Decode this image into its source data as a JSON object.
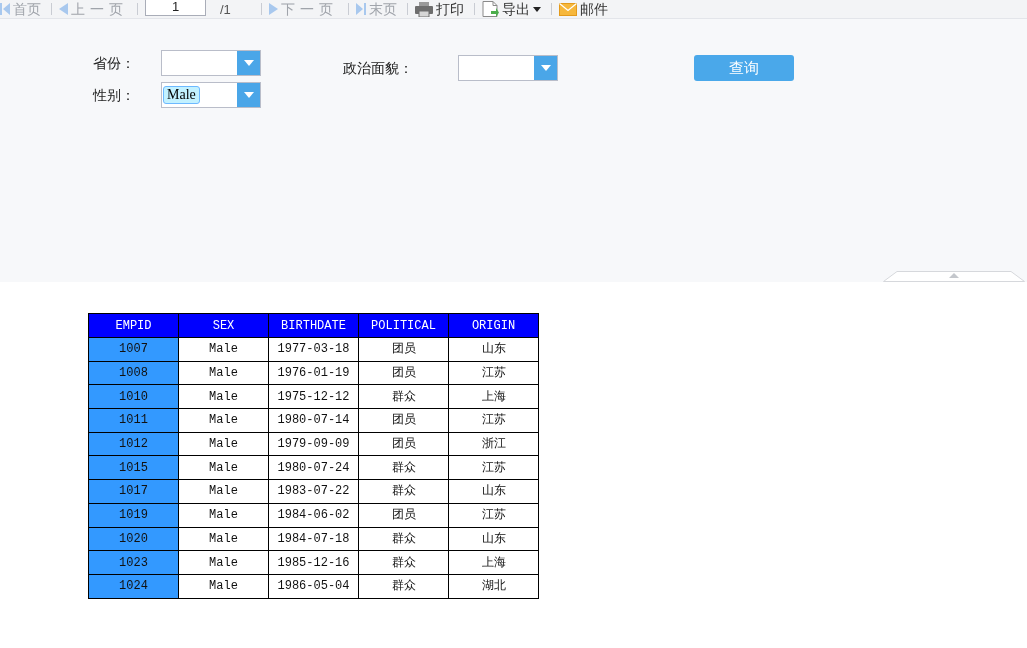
{
  "toolbar": {
    "items": [
      {
        "kind": "first",
        "label": "首页",
        "disabled": true
      },
      {
        "kind": "prev",
        "label": "上一页",
        "disabled": true
      },
      {
        "kind": "page",
        "value": "1"
      },
      {
        "kind": "total",
        "label": "/1"
      },
      {
        "kind": "next",
        "label": "下一页",
        "disabled": true
      },
      {
        "kind": "last",
        "label": "末页",
        "disabled": true
      },
      {
        "kind": "print",
        "label": "打印",
        "disabled": false
      },
      {
        "kind": "export",
        "label": "导出",
        "disabled": false
      },
      {
        "kind": "mail",
        "label": "邮件",
        "disabled": false
      }
    ]
  },
  "filters": {
    "fields": [
      {
        "label": "省份："
      },
      {
        "label": "性别：",
        "tags": [
          "Male"
        ]
      },
      {
        "label": "政治面貌："
      }
    ],
    "button": "查询"
  },
  "table": {
    "columns": [
      "EMPID",
      "SEX",
      "BIRTHDATE",
      "POLITICAL",
      "ORIGIN"
    ],
    "rows": [
      [
        "1007",
        "Male",
        "1977-03-18",
        "团员",
        "山东"
      ],
      [
        "1008",
        "Male",
        "1976-01-19",
        "团员",
        "江苏"
      ],
      [
        "1010",
        "Male",
        "1975-12-12",
        "群众",
        "上海"
      ],
      [
        "1011",
        "Male",
        "1980-07-14",
        "团员",
        "江苏"
      ],
      [
        "1012",
        "Male",
        "1979-09-09",
        "团员",
        "浙江"
      ],
      [
        "1015",
        "Male",
        "1980-07-24",
        "群众",
        "江苏"
      ],
      [
        "1017",
        "Male",
        "1983-07-22",
        "群众",
        "山东"
      ],
      [
        "1019",
        "Male",
        "1984-06-02",
        "团员",
        "江苏"
      ],
      [
        "1020",
        "Male",
        "1984-07-18",
        "群众",
        "山东"
      ],
      [
        "1023",
        "Male",
        "1985-12-16",
        "群众",
        "上海"
      ],
      [
        "1024",
        "Male",
        "1986-05-04",
        "群众",
        "湖北"
      ]
    ]
  }
}
